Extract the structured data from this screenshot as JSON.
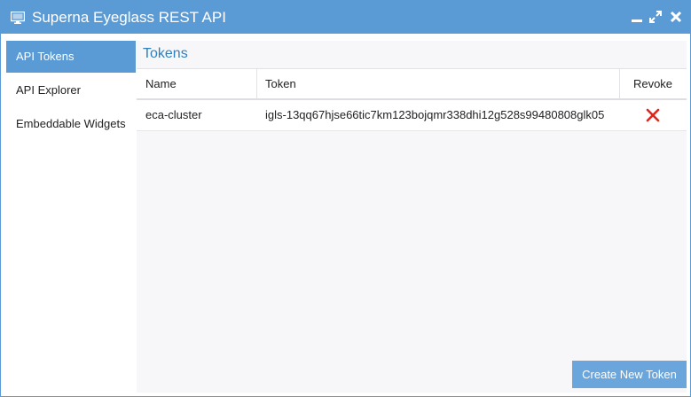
{
  "window": {
    "title": "Superna Eyeglass REST API",
    "icon": "monitor-icon",
    "controls": [
      "minimize-icon",
      "maximize-icon",
      "close-icon"
    ]
  },
  "sidebar": {
    "items": [
      {
        "label": "API Tokens",
        "active": true
      },
      {
        "label": "API Explorer",
        "active": false
      },
      {
        "label": "Embeddable Widgets",
        "active": false
      }
    ]
  },
  "main": {
    "title": "Tokens",
    "table": {
      "columns": [
        "Name",
        "Token",
        "Revoke"
      ],
      "rows": [
        {
          "name": "eca-cluster",
          "token": "igls-13qq67hjse66tic7km123bojqmr338dhi12g528s99480808glk05",
          "revoke_icon": "x-icon"
        }
      ]
    },
    "create_button_label": "Create New Token"
  },
  "colors": {
    "accent": "#5b9bd5",
    "title_text": "#2f7fbf",
    "revoke": "#e0251d",
    "button": "#6aa6dc"
  }
}
